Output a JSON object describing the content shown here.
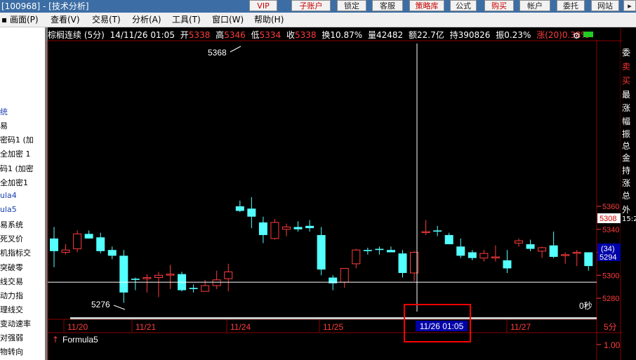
{
  "window": {
    "title": "[100968] - [技术分析]",
    "top_buttons": [
      "VIP",
      "子账户",
      "锁定",
      "客服",
      "策略库",
      "公式",
      "购买",
      "帐户",
      "委托",
      "网站"
    ]
  },
  "menu": [
    "画面(P)",
    "查看(V)",
    "交易(T)",
    "分析(A)",
    "工具(T)",
    "窗口(W)",
    "帮助(H)"
  ],
  "sidebar": {
    "items": [
      "统",
      "易",
      "密码1 (加",
      "全加密 1",
      "码1 (加密",
      "全加密1",
      "ula4",
      "ula5",
      "易系统",
      "死叉价",
      "机指标交",
      "突破零",
      "线交易",
      "动力指",
      "理线交",
      "变动速率",
      "对强弱",
      "物转向"
    ]
  },
  "info": {
    "name": "棕榈连续 (5分)",
    "time": "14/11/26 01:05",
    "open_label": "开",
    "open": "5338",
    "high_label": "高",
    "high": "5346",
    "low_label": "低",
    "low": "5334",
    "close_label": "收",
    "close": "5338",
    "turnover_label": "换",
    "turnover": "10.87%",
    "volume_label": "量",
    "volume": "42482",
    "amount_label": "额",
    "amount": "22.7亿",
    "oi_label": "持",
    "oi": "390826",
    "amp_label": "振",
    "amp": "0.23%",
    "chg_label": "涨(20)",
    "chg": "0.38%"
  },
  "chart_data": {
    "type": "candlestick",
    "period": "5分",
    "ylim": [
      5272,
      5370
    ],
    "y_ticks": [
      5280,
      5300,
      5320,
      5340,
      5360
    ],
    "x_labels": [
      "11/20",
      "11/21",
      "11/24",
      "11/25",
      "11/26 01:05",
      "11/27"
    ],
    "candles": [
      {
        "o": 5332,
        "h": 5342,
        "l": 5307,
        "c": 5321
      },
      {
        "o": 5320,
        "h": 5327,
        "l": 5318,
        "c": 5322
      },
      {
        "o": 5323,
        "h": 5339,
        "l": 5320,
        "c": 5336
      },
      {
        "o": 5336,
        "h": 5339,
        "l": 5332,
        "c": 5332
      },
      {
        "o": 5333,
        "h": 5337,
        "l": 5319,
        "c": 5321
      },
      {
        "o": 5322,
        "h": 5325,
        "l": 5314,
        "c": 5317
      },
      {
        "o": 5317,
        "h": 5322,
        "l": 5276,
        "c": 5285
      },
      {
        "o": 5297,
        "h": 5298,
        "l": 5287,
        "c": 5296
      },
      {
        "o": 5297,
        "h": 5301,
        "l": 5285,
        "c": 5298
      },
      {
        "o": 5298,
        "h": 5303,
        "l": 5281,
        "c": 5300
      },
      {
        "o": 5301,
        "h": 5309,
        "l": 5288,
        "c": 5301
      },
      {
        "o": 5301,
        "h": 5303,
        "l": 5286,
        "c": 5287
      },
      {
        "o": 5289,
        "h": 5292,
        "l": 5285,
        "c": 5288
      },
      {
        "o": 5286,
        "h": 5296,
        "l": 5286,
        "c": 5291
      },
      {
        "o": 5291,
        "h": 5304,
        "l": 5288,
        "c": 5296
      },
      {
        "o": 5297,
        "h": 5310,
        "l": 5286,
        "c": 5303
      },
      {
        "o": 5360,
        "h": 5365,
        "l": 5355,
        "c": 5356
      },
      {
        "o": 5358,
        "h": 5368,
        "l": 5341,
        "c": 5351
      },
      {
        "o": 5346,
        "h": 5351,
        "l": 5328,
        "c": 5335
      },
      {
        "o": 5332,
        "h": 5349,
        "l": 5331,
        "c": 5346
      },
      {
        "o": 5340,
        "h": 5345,
        "l": 5334,
        "c": 5342
      },
      {
        "o": 5342,
        "h": 5347,
        "l": 5338,
        "c": 5340
      },
      {
        "o": 5343,
        "h": 5348,
        "l": 5338,
        "c": 5341
      },
      {
        "o": 5335,
        "h": 5342,
        "l": 5300,
        "c": 5305
      },
      {
        "o": 5298,
        "h": 5300,
        "l": 5287,
        "c": 5293
      },
      {
        "o": 5294,
        "h": 5306,
        "l": 5289,
        "c": 5306
      },
      {
        "o": 5310,
        "h": 5323,
        "l": 5306,
        "c": 5322
      },
      {
        "o": 5322,
        "h": 5324,
        "l": 5318,
        "c": 5321
      },
      {
        "o": 5323,
        "h": 5325,
        "l": 5318,
        "c": 5322
      },
      {
        "o": 5322,
        "h": 5325,
        "l": 5320,
        "c": 5320
      },
      {
        "o": 5319,
        "h": 5322,
        "l": 5298,
        "c": 5302
      },
      {
        "o": 5302,
        "h": 5321,
        "l": 5295,
        "c": 5320
      },
      {
        "o": 5338,
        "h": 5348,
        "l": 5335,
        "c": 5338
      },
      {
        "o": 5339,
        "h": 5343,
        "l": 5334,
        "c": 5338
      },
      {
        "o": 5335,
        "h": 5337,
        "l": 5327,
        "c": 5327
      },
      {
        "o": 5325,
        "h": 5332,
        "l": 5315,
        "c": 5317
      },
      {
        "o": 5320,
        "h": 5322,
        "l": 5313,
        "c": 5315
      },
      {
        "o": 5315,
        "h": 5322,
        "l": 5312,
        "c": 5319
      },
      {
        "o": 5316,
        "h": 5326,
        "l": 5312,
        "c": 5316
      },
      {
        "o": 5313,
        "h": 5322,
        "l": 5302,
        "c": 5306
      },
      {
        "o": 5328,
        "h": 5332,
        "l": 5325,
        "c": 5330
      },
      {
        "o": 5327,
        "h": 5331,
        "l": 5321,
        "c": 5323
      },
      {
        "o": 5321,
        "h": 5325,
        "l": 5315,
        "c": 5324
      },
      {
        "o": 5326,
        "h": 5338,
        "l": 5315,
        "c": 5316
      },
      {
        "o": 5318,
        "h": 5320,
        "l": 5310,
        "c": 5318
      },
      {
        "o": 5320,
        "h": 5322,
        "l": 5308,
        "c": 5320
      },
      {
        "o": 5320,
        "h": 5320,
        "l": 5304,
        "c": 5308
      }
    ],
    "annotations": [
      {
        "label": "5368",
        "value": 5368
      },
      {
        "label": "5276",
        "value": 5276
      }
    ],
    "current_price": "5308",
    "crosshair_price": "5294",
    "crosshair_count": "(34)",
    "countdown": "0秒",
    "indicator_name": "Formula5",
    "indicator_tick": "1.00",
    "colors": {
      "up": "#ff3c3c",
      "down": "#54ffff",
      "grid": "#8b0000",
      "crosshair": "#ffffff",
      "highlight": "#ff0000",
      "xlabel": "#ff3c3c"
    }
  },
  "right_panel": [
    "委",
    "卖",
    "买",
    "最",
    "涨",
    "幅",
    "振",
    "总",
    "金",
    "持",
    "涨",
    "总",
    "外",
    "15:2"
  ]
}
